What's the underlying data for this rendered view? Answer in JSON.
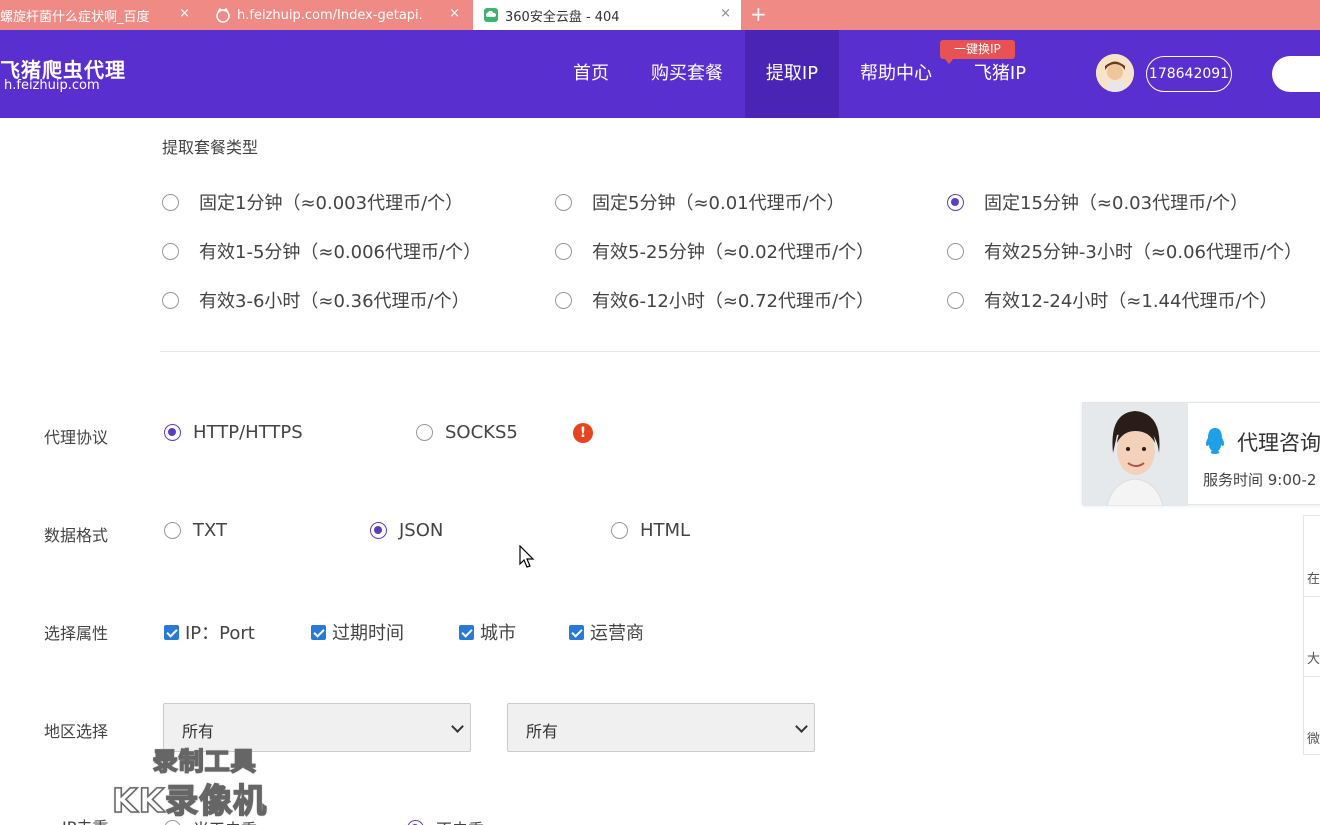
{
  "browser": {
    "tabs": [
      {
        "title": "螺旋杆菌什么症状啊_百度",
        "close": "×"
      },
      {
        "title": "h.feizhuip.com/Index-getapi.",
        "close": "×"
      },
      {
        "title": "360安全云盘 - 404",
        "close": "×"
      }
    ],
    "new_tab": "+"
  },
  "header": {
    "logo_title": "飞猪爬虫代理",
    "logo_domain": "h.feizhuip.com",
    "nav": [
      "首页",
      "购买套餐",
      "提取IP",
      "帮助中心",
      "飞猪IP"
    ],
    "active_nav": "提取IP",
    "badge": "一键换IP",
    "user_id": "178642091"
  },
  "package": {
    "title": "提取套餐类型",
    "options": [
      {
        "label": "固定1分钟（≈0.003代理币/个）",
        "checked": false
      },
      {
        "label": "固定5分钟（≈0.01代理币/个）",
        "checked": false
      },
      {
        "label": "固定15分钟（≈0.03代理币/个）",
        "checked": true
      },
      {
        "label": "有效1-5分钟（≈0.006代理币/个）",
        "checked": false
      },
      {
        "label": "有效5-25分钟（≈0.02代理币/个）",
        "checked": false
      },
      {
        "label": "有效25分钟-3小时（≈0.06代理币/个）",
        "checked": false
      },
      {
        "label": "有效3-6小时（≈0.36代理币/个）",
        "checked": false
      },
      {
        "label": "有效6-12小时（≈0.72代理币/个）",
        "checked": false
      },
      {
        "label": "有效12-24小时（≈1.44代理币/个）",
        "checked": false
      }
    ]
  },
  "protocol": {
    "label": "代理协议",
    "options": [
      {
        "label": "HTTP/HTTPS",
        "checked": true
      },
      {
        "label": "SOCKS5",
        "checked": false
      }
    ],
    "warn": "!"
  },
  "format": {
    "label": "数据格式",
    "options": [
      {
        "label": "TXT",
        "checked": false
      },
      {
        "label": "JSON",
        "checked": true
      },
      {
        "label": "HTML",
        "checked": false
      }
    ]
  },
  "attributes": {
    "label": "选择属性",
    "options": [
      {
        "label": "IP：Port",
        "checked": true
      },
      {
        "label": "过期时间",
        "checked": true
      },
      {
        "label": "城市",
        "checked": true
      },
      {
        "label": "运营商",
        "checked": true
      }
    ]
  },
  "region": {
    "label": "地区选择",
    "province": "所有",
    "city": "所有"
  },
  "consult": {
    "title": "代理咨询",
    "time": "服务时间 9:00-2"
  },
  "side_panel": [
    "在",
    "大",
    "微"
  ],
  "watermark": {
    "line1": "录制工具",
    "line2": "KK录像机"
  },
  "cutoff_row": {
    "label": "IP去重",
    "opt1": "当天去重",
    "opt2": "不去重"
  },
  "colors": {
    "header": "#5a2fd0",
    "accent": "#5a3fc0",
    "tab_bar": "#f08a84",
    "checkbox": "#2979d6",
    "warn": "#e8431f"
  }
}
